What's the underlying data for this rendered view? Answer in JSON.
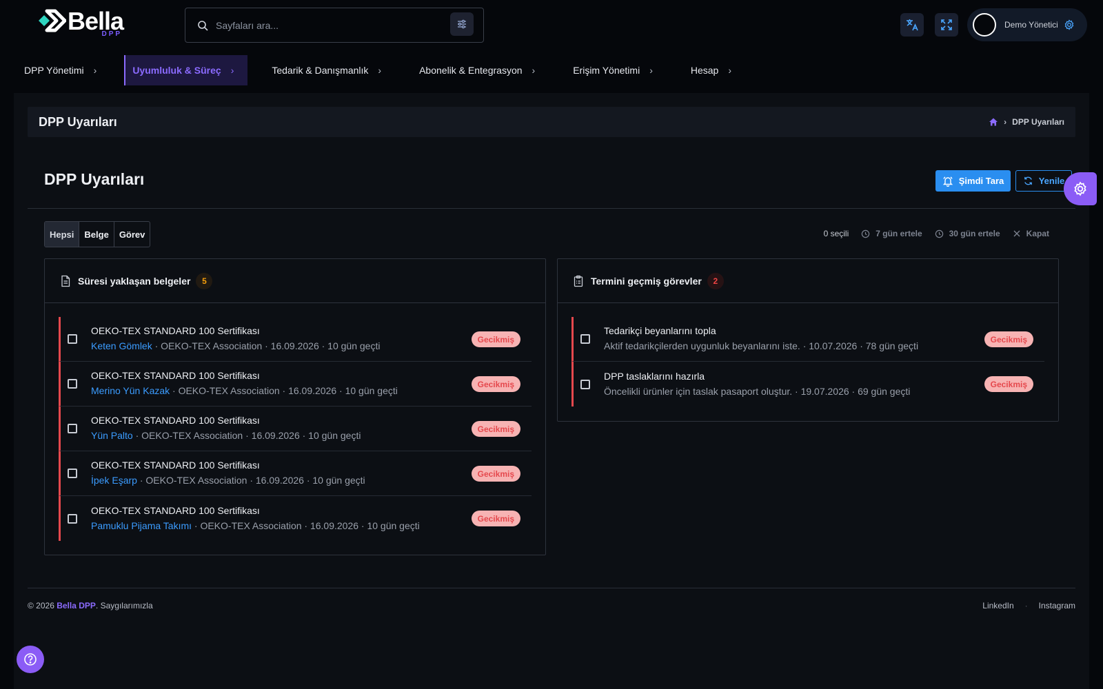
{
  "brand": {
    "name": "Bella",
    "sub": "DPP"
  },
  "search": {
    "placeholder": "Sayfaları ara..."
  },
  "topbar": {
    "translate_icon": "translate-icon",
    "fullscreen_icon": "fullscreen-icon",
    "user_name": "Demo Yönetici",
    "settings_icon": "gear-icon"
  },
  "nav": {
    "items": [
      {
        "label": "DPP Yönetimi"
      },
      {
        "label": "Uyumluluk & Süreç",
        "active": true
      },
      {
        "label": "Tedarik & Danışmanlık"
      },
      {
        "label": "Abonelik & Entegrasyon"
      },
      {
        "label": "Erişim Yönetimi"
      },
      {
        "label": "Hesap"
      }
    ],
    "chevron": "›"
  },
  "breadcrumb": {
    "title": "DPP Uyarıları",
    "current": "DPP Uyarıları",
    "separator": "›"
  },
  "page": {
    "title": "DPP Uyarıları",
    "scan_button": "Şimdi Tara",
    "refresh_button": "Yenile"
  },
  "filters": {
    "all": "Hepsi",
    "document": "Belge",
    "task": "Görev",
    "selected_tab": "Hepsi"
  },
  "bulk": {
    "selected": "0 seçili",
    "snooze7": "7 gün ertele",
    "snooze30": "30 gün ertele",
    "close": "Kapat"
  },
  "documents": {
    "title": "Süresi yaklaşan belgeler",
    "count": "5",
    "items": [
      {
        "title": "OEKO-TEX STANDARD 100 Sertifikası",
        "product": "Keten Gömlek",
        "meta": " · OEKO-TEX Association · 16.09.2026 · 10 gün geçti",
        "status": "Gecikmiş"
      },
      {
        "title": "OEKO-TEX STANDARD 100 Sertifikası",
        "product": "Merino Yün Kazak",
        "meta": " · OEKO-TEX Association · 16.09.2026 · 10 gün geçti",
        "status": "Gecikmiş"
      },
      {
        "title": "OEKO-TEX STANDARD 100 Sertifikası",
        "product": "Yün Palto",
        "meta": " · OEKO-TEX Association · 16.09.2026 · 10 gün geçti",
        "status": "Gecikmiş"
      },
      {
        "title": "OEKO-TEX STANDARD 100 Sertifikası",
        "product": "İpek Eşarp",
        "meta": " · OEKO-TEX Association · 16.09.2026 · 10 gün geçti",
        "status": "Gecikmiş"
      },
      {
        "title": "OEKO-TEX STANDARD 100 Sertifikası",
        "product": "Pamuklu Pijama Takımı",
        "meta": " · OEKO-TEX Association · 16.09.2026 · 10 gün geçti",
        "status": "Gecikmiş"
      }
    ]
  },
  "tasks": {
    "title": "Termini geçmiş görevler",
    "count": "2",
    "items": [
      {
        "title": "Tedarikçi beyanlarını topla",
        "meta": "Aktif tedarikçilerden uygunluk beyanlarını iste. · 10.07.2026 · 78 gün geçti",
        "status": "Gecikmiş"
      },
      {
        "title": "DPP taslaklarını hazırla",
        "meta": "Öncelikli ürünler için taslak pasaport oluştur. · 19.07.2026 · 69 gün geçti",
        "status": "Gecikmiş"
      }
    ]
  },
  "footer": {
    "copy_prefix": "© 2026 ",
    "brand": "Bella DPP",
    "copy_suffix": ". Saygılarımızla",
    "links": [
      "LinkedIn",
      "Instagram"
    ],
    "link_sep": "·"
  },
  "colors": {
    "accent": "#8b5cf6",
    "primary": "#2a8ef0",
    "danger": "#e5484d",
    "link": "#3b9cff",
    "warning": "#f59e0b"
  }
}
